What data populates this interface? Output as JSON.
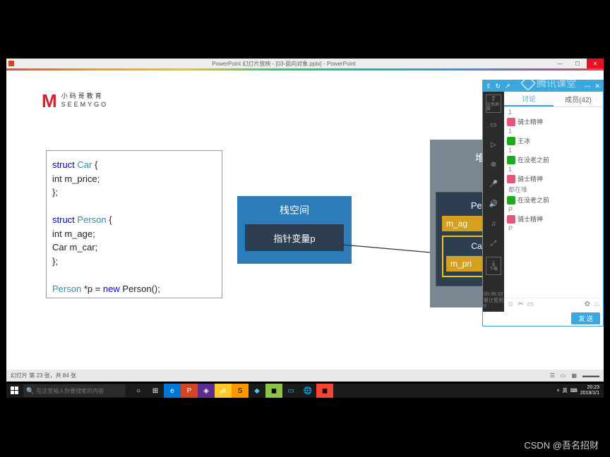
{
  "titlebar": {
    "text": "PowerPoint 幻灯片放映 - [03-面向对象.pptx] - PowerPoint"
  },
  "logo": {
    "cn": "小码哥教育",
    "en": "SEEMYGO"
  },
  "code": {
    "l1a": "struct",
    "l1b": "Car",
    "l1c": " {",
    "l2": "    int m_price;",
    "l3": "};",
    "l4a": "struct",
    "l4b": "Person",
    "l4c": " {",
    "l5": "    int m_age;",
    "l6": "    Car m_car;",
    "l7": "};",
    "l8a": "Person",
    "l8b": " *p = ",
    "l8c": "new",
    "l8d": " Person();"
  },
  "stack": {
    "title": "栈空间",
    "var": "指针变量p"
  },
  "heap": {
    "title": "堆空间",
    "person": "Person对",
    "f1": "m_ag",
    "car": "Car对象 n",
    "f2": "m_pri"
  },
  "status": {
    "left": "幻灯片 第 23 张，共 84 张"
  },
  "watermark": "腾讯课堂",
  "chat": {
    "tab1": "讨论",
    "tab2": "成员(42)",
    "share": "分享屏幕",
    "download": "下载",
    "timer": "00:36:33",
    "stat1": "累计签到",
    "stat2": "0",
    "msgs": [
      {
        "t": "1"
      },
      {
        "av": "p",
        "n": "骑士精神"
      },
      {
        "t": "1"
      },
      {
        "av": "w",
        "n": "王冰"
      },
      {
        "t": "1"
      },
      {
        "av": "w",
        "n": "在没老之前"
      },
      {
        "t": "1"
      },
      {
        "av": "p",
        "n": "骑士精神"
      },
      {
        "t": "都在堆"
      },
      {
        "av": "w",
        "n": "在没老之前"
      },
      {
        "t": "P"
      },
      {
        "av": "p",
        "n": "骑士精神"
      },
      {
        "t": "P"
      }
    ],
    "send": "发 送"
  },
  "taskbar": {
    "search_ph": "在这里输入你要搜索的内容",
    "time": "20:23",
    "date": "2019/1/1"
  },
  "csdn": "CSDN @吾名招财"
}
